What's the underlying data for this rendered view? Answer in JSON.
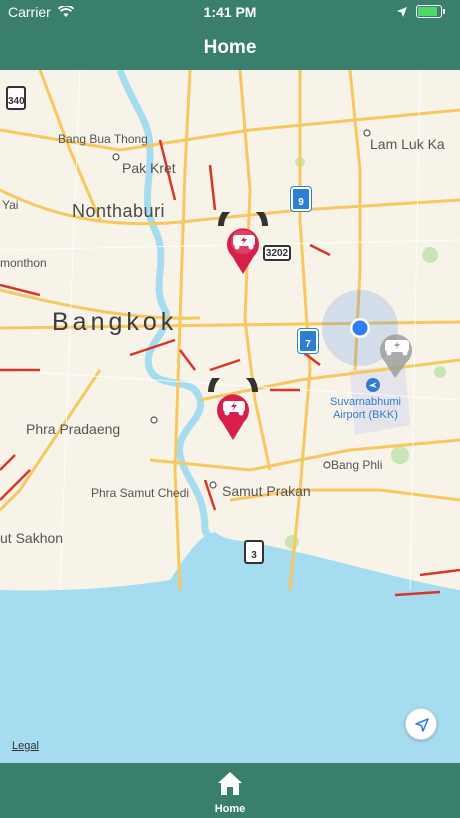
{
  "status_bar": {
    "carrier": "Carrier",
    "time": "1:41 PM",
    "wifi_icon": "wifi-icon",
    "location_icon": "location-arrow-icon",
    "battery_level": 0.85,
    "battery_color": "#4cd964"
  },
  "nav": {
    "title": "Home"
  },
  "map": {
    "labels": {
      "bang_bua_thong": "Bang Bua Thong",
      "pak_kret": "Pak Kret",
      "lam_luk_ka": "Lam Luk Ka",
      "yai": "Yai",
      "nonthaburi": "Nonthaburi",
      "monthon": "monthon",
      "bangkok": "Bangkok",
      "suvarnabhumi": "Suvarnabhumi",
      "airport_bkk": "Airport (BKK)",
      "phra_pradaeng": "Phra Pradaeng",
      "bang_phli": "Bang Phli",
      "phra_samut_chedi": "Phra Samut Chedi",
      "samut_prakan": "Samut Prakan",
      "samut_sakhon": "ut Sakhon",
      "legal": "Legal"
    },
    "shields": {
      "route_340": "340",
      "route_9": "9",
      "route_3202": "3202",
      "route_7": "7",
      "route_3": "3"
    },
    "markers": [
      {
        "name": "charging-station-marker",
        "status": "disconnected",
        "color": "#d81e4b"
      },
      {
        "name": "charging-station-marker",
        "status": "disconnected",
        "color": "#d81e4b"
      },
      {
        "name": "charging-station-marker",
        "status": "inactive",
        "color": "#9e9e9e"
      }
    ],
    "colors": {
      "water": "#a6dcf0",
      "land": "#f8f3e8",
      "highway": "#f6c85f",
      "traffic": "#d9362a",
      "user_location": "#2f7cf6"
    }
  },
  "tab_bar": {
    "items": [
      {
        "label": "Home",
        "icon": "home-icon",
        "selected": true
      }
    ]
  },
  "theme": {
    "primary": "#3a7f6c"
  }
}
